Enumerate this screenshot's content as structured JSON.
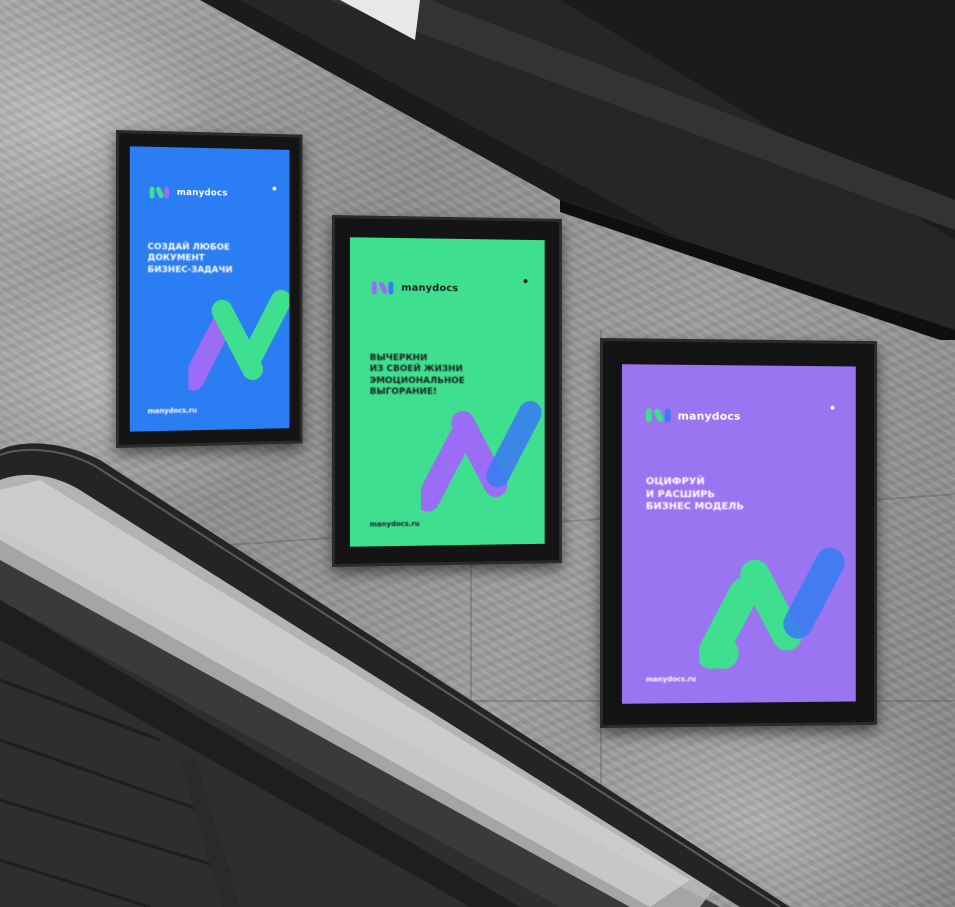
{
  "scene": {
    "description_colors": {
      "wall": "#9a9a9a",
      "ceiling": "#1c1c1c",
      "escalator_rail": "#2a2a2a"
    }
  },
  "posters": [
    {
      "id": "blue",
      "bg": "#2a7df2",
      "brand_name": "manydocs",
      "headline": [
        "СОЗДАЙ ЛЮБОЕ",
        "ДОКУМЕНТ",
        "БИЗНЕС-ЗАДАЧИ"
      ],
      "url": "manydocs.ru",
      "text_color": "#ffffff",
      "logo_colors": [
        "#3ee08f",
        "#9b6cf5"
      ]
    },
    {
      "id": "green",
      "bg": "#3ee08f",
      "brand_name": "manydocs",
      "headline": [
        "ВЫЧЕРКНИ",
        "ИЗ СВОЕЙ ЖИЗНИ",
        "ЭМОЦИОНАЛЬНОЕ",
        "ВЫГОРАНИЕ!"
      ],
      "url": "manydocs.ru",
      "text_color": "#1e1e1e",
      "logo_colors": [
        "#9b6cf5",
        "#3a7df2"
      ]
    },
    {
      "id": "purple",
      "bg": "#9b74f2",
      "brand_name": "manydocs",
      "headline": [
        "ОЦИФРУЙ",
        "И РАСШИРЬ",
        "БИЗНЕС МОДЕЛЬ"
      ],
      "url": "manydocs.ru",
      "text_color": "#ffffff",
      "logo_colors": [
        "#3ee08f",
        "#3a7df2"
      ]
    }
  ]
}
